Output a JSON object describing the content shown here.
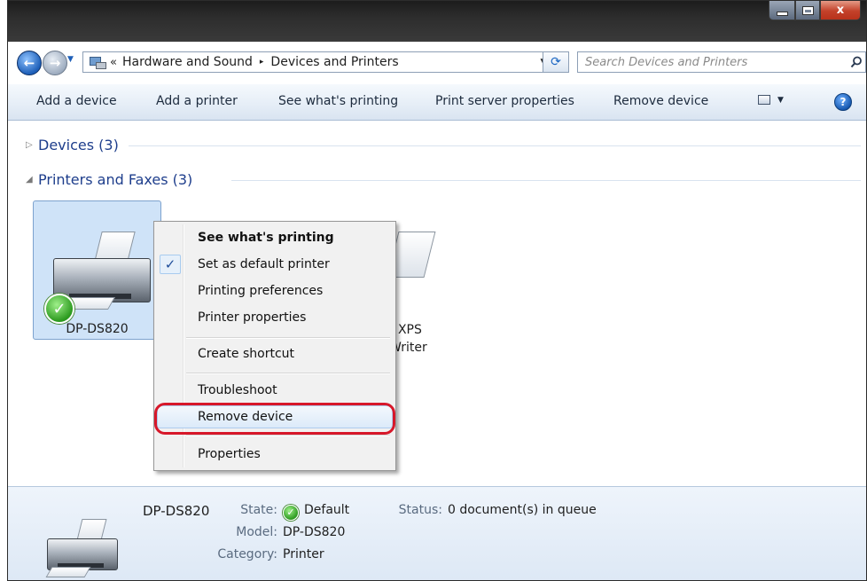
{
  "window": {
    "title": "",
    "controls": {
      "minimize_icon": "minimize-icon",
      "maximize_icon": "maximize-icon",
      "close_label": "x"
    }
  },
  "nav": {
    "back_icon": "back-arrow-icon",
    "forward_icon": "forward-arrow-icon",
    "address": {
      "overflow_chevron": "«",
      "crumbs": [
        "Hardware and Sound",
        "Devices and Printers"
      ],
      "separator": "▸"
    },
    "search_placeholder": "Search Devices and Printers"
  },
  "toolbar": {
    "add_device": "Add a device",
    "add_printer": "Add a printer",
    "see_printing": "See what's printing",
    "print_server": "Print server properties",
    "remove_device": "Remove device",
    "help": "?"
  },
  "groups": {
    "devices": {
      "label": "Devices (3)",
      "expanded": false
    },
    "printers": {
      "label": "Printers and Faxes (3)",
      "expanded": true
    }
  },
  "printers": [
    {
      "name": "DP-DS820",
      "selected": true,
      "default": true
    },
    {
      "name_fragment_1": "t XPS",
      "name_fragment_2": "Writer"
    }
  ],
  "context_menu": {
    "items": [
      {
        "label": "See what's printing",
        "bold": true
      },
      {
        "label": "Set as default printer",
        "checked": true
      },
      {
        "label": "Printing preferences"
      },
      {
        "label": "Printer properties"
      },
      {
        "label": "Create shortcut"
      },
      {
        "label": "Troubleshoot"
      },
      {
        "label": "Remove device",
        "highlighted": true
      },
      {
        "label": "Properties"
      }
    ],
    "check_mark": "✓"
  },
  "details": {
    "name": "DP-DS820",
    "state_label": "State:",
    "state_value": "Default",
    "model_label": "Model:",
    "model_value": "DP-DS820",
    "category_label": "Category:",
    "category_value": "Printer",
    "status_label": "Status:",
    "status_value": "0 document(s) in queue"
  },
  "colors": {
    "accent": "#1e3e8c",
    "highlight_ring": "#d7182a",
    "selection": "#cfe3f8"
  }
}
